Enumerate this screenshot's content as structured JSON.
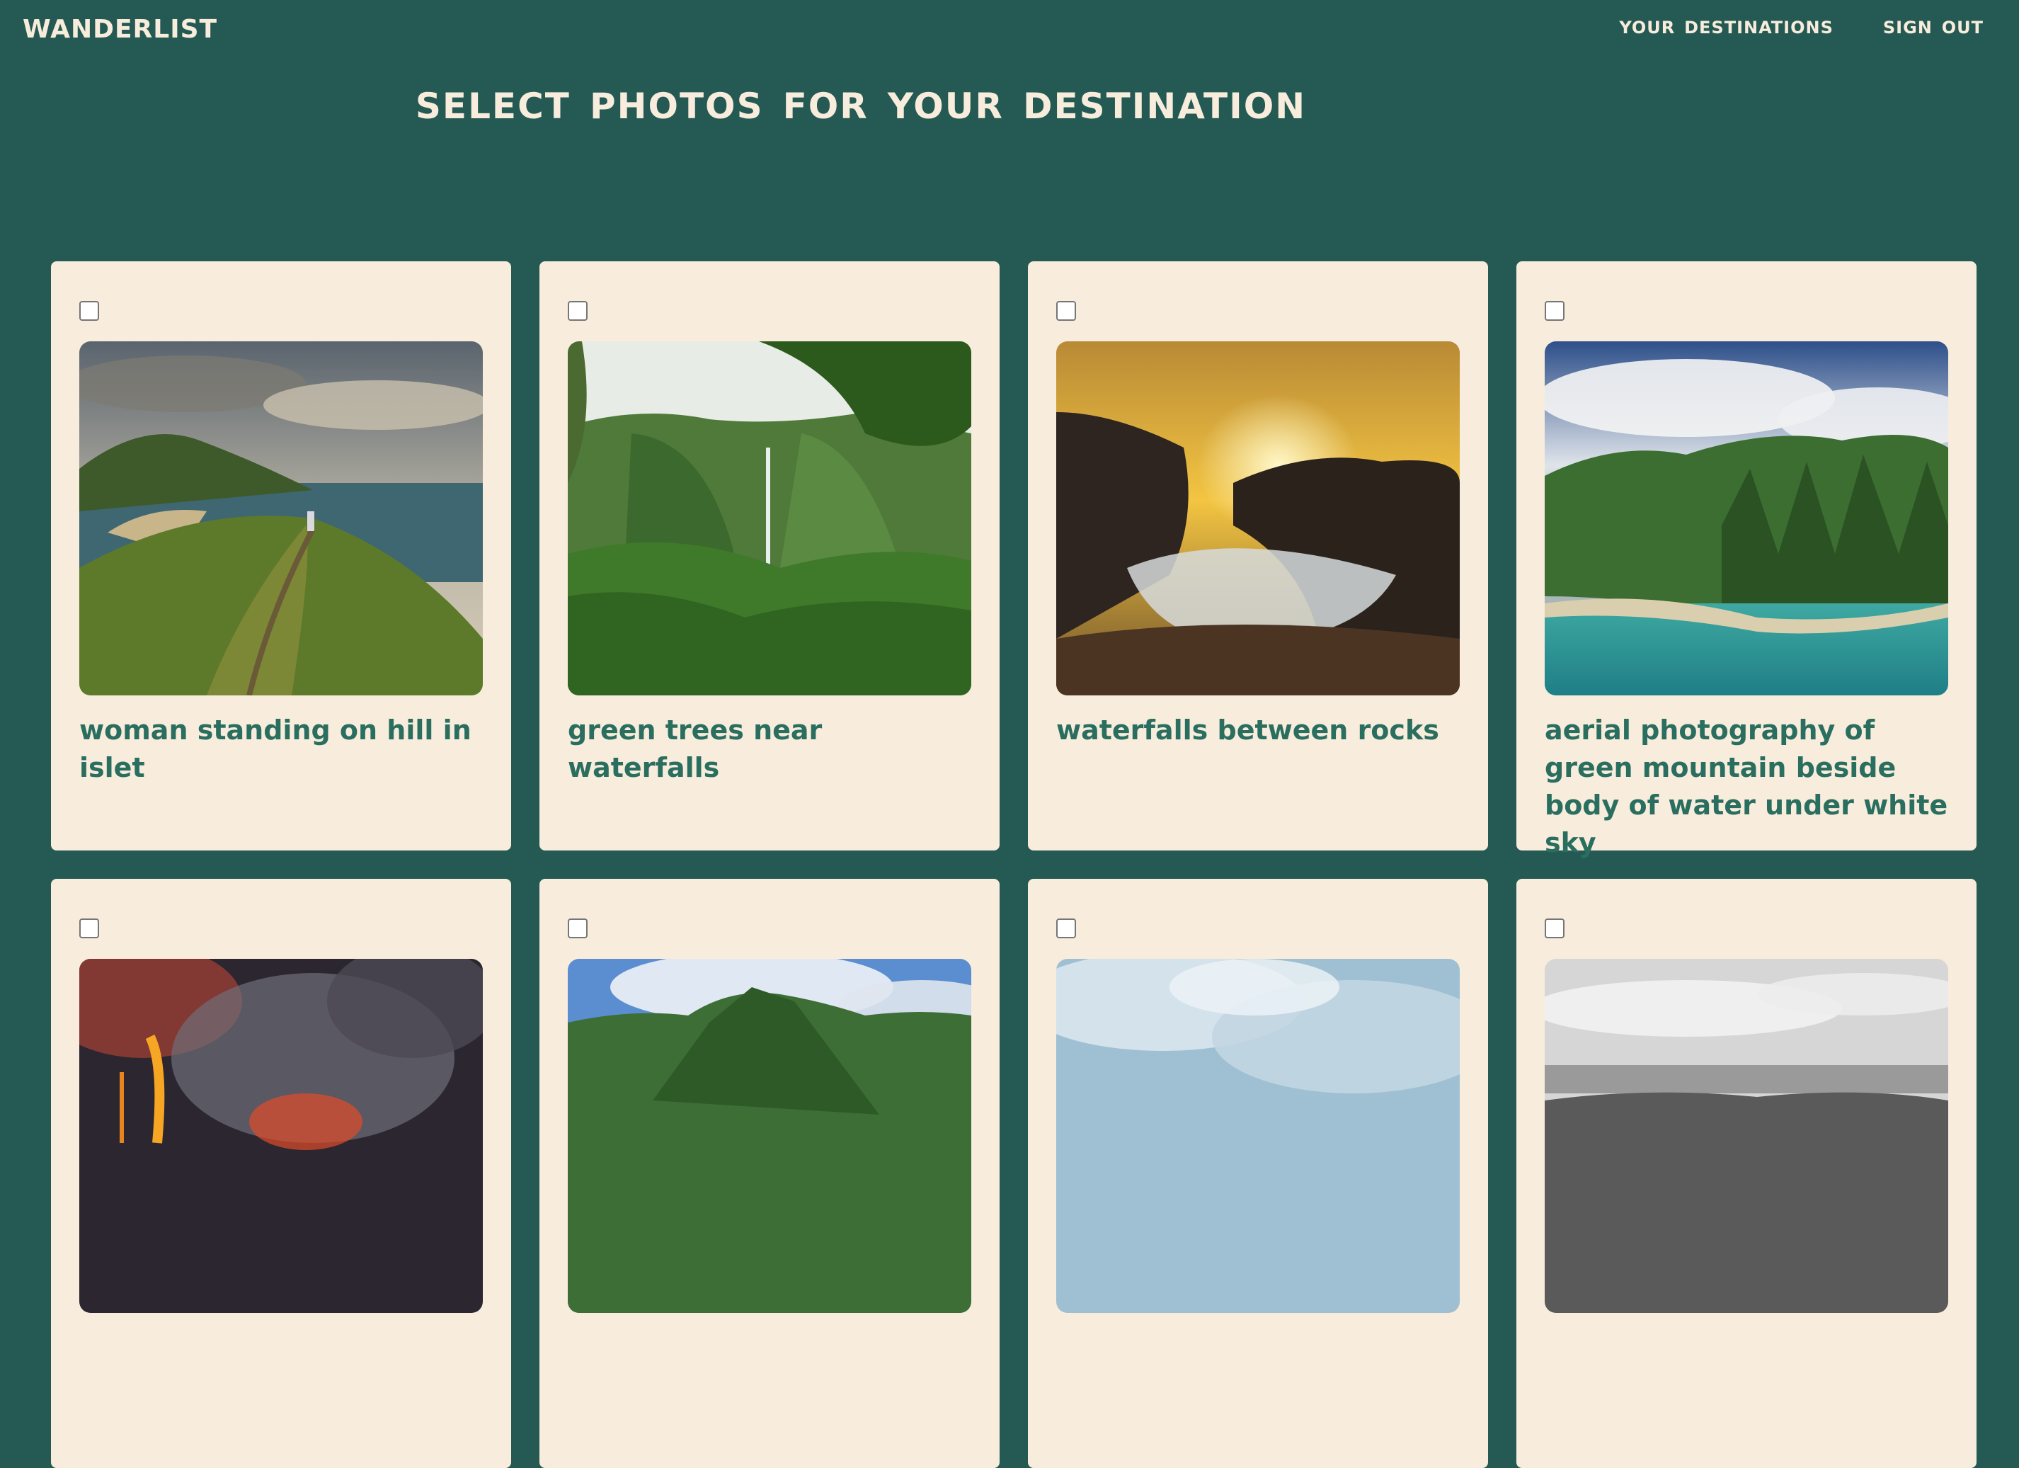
{
  "header": {
    "logo": "wanderlist",
    "nav": [
      "your destinations",
      "sign out"
    ]
  },
  "page_title": "select photos for your destination",
  "photos": [
    {
      "caption": "woman standing on hill in islet",
      "checked": false
    },
    {
      "caption": "green trees near waterfalls",
      "checked": false
    },
    {
      "caption": "waterfalls between rocks",
      "checked": false
    },
    {
      "caption": "aerial photography of green mountain beside body of water under white sky",
      "checked": false
    },
    {
      "caption": "",
      "checked": false
    },
    {
      "caption": "",
      "checked": false
    },
    {
      "caption": "",
      "checked": false
    },
    {
      "caption": "",
      "checked": false
    }
  ],
  "colors": {
    "background": "#245a53",
    "card": "#f8ecdc",
    "caption": "#2a6e5f",
    "header_text": "#f8ecdc"
  }
}
